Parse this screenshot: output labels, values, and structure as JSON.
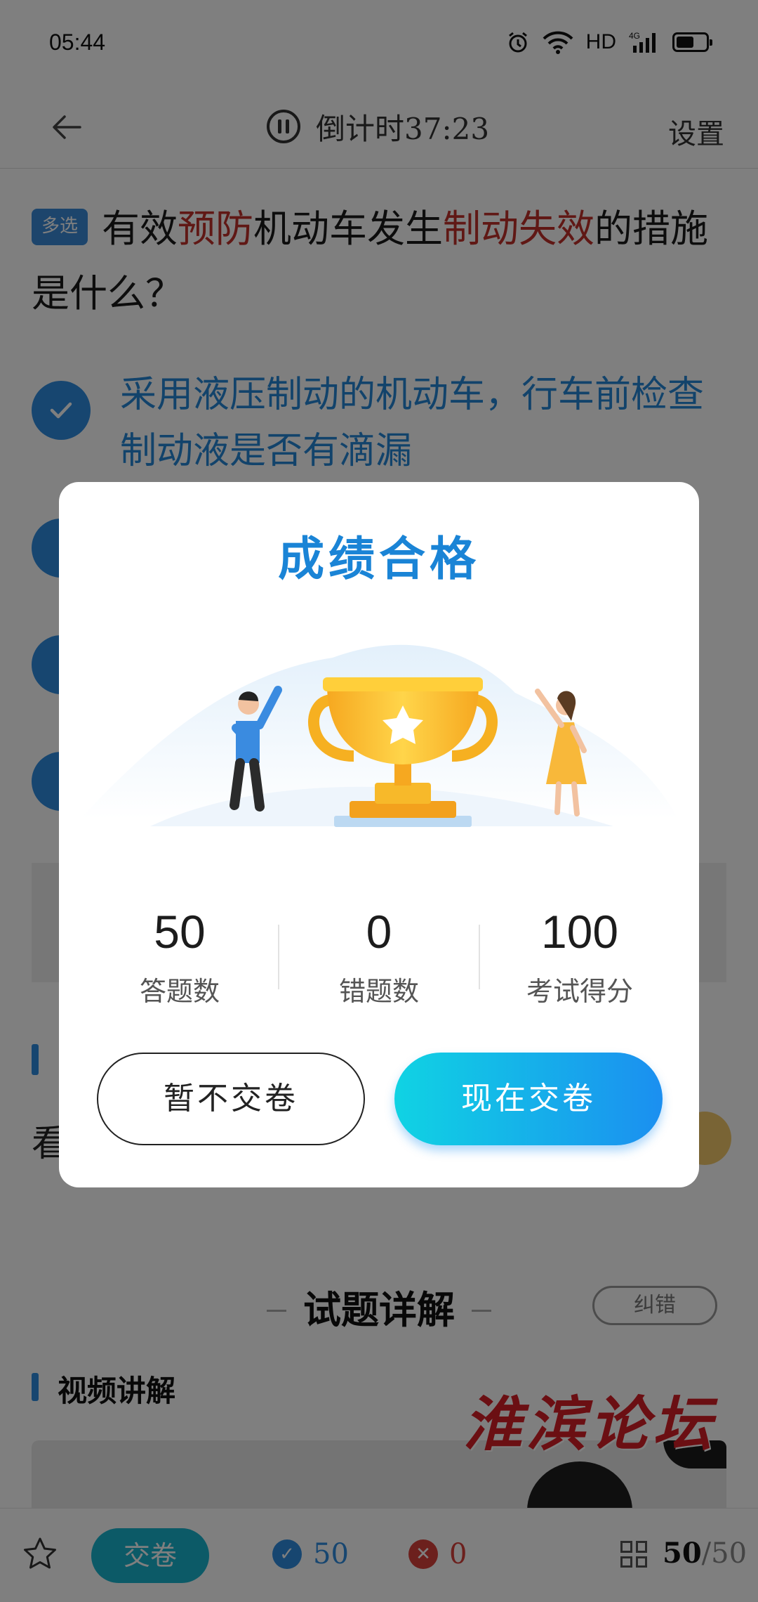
{
  "status_bar": {
    "time": "05:44",
    "network": "HD",
    "signal": "4G"
  },
  "nav": {
    "timer": "倒计时37:23",
    "settings": "设置"
  },
  "question": {
    "type_badge": "多选",
    "text_parts": [
      "有效",
      "预防",
      "机动车发生",
      "制动失效",
      "的措施是什么？"
    ]
  },
  "options": [
    {
      "text": "采用液压制动的机动车，行车前检查制动液是否有滴漏"
    }
  ],
  "partial_text": "看",
  "explain": {
    "title": "试题详解",
    "correct_button": "纠错",
    "video_title": "视频讲解"
  },
  "watermark": "淮滨论坛",
  "bottom": {
    "submit": "交卷",
    "correct_count": "50",
    "wrong_count": "0",
    "progress_current": "50",
    "progress_total": "/50"
  },
  "modal": {
    "title": "成绩合格",
    "stats": [
      {
        "value": "50",
        "label": "答题数"
      },
      {
        "value": "0",
        "label": "错题数"
      },
      {
        "value": "100",
        "label": "考试得分"
      }
    ],
    "cancel_button": "暂不交卷",
    "submit_button": "现在交卷"
  },
  "colors": {
    "accent": "#2e8ce0",
    "keyword": "#c0302a",
    "title_blue": "#1a84d6",
    "gradient_start": "#10d3e3",
    "gradient_end": "#1b8ff0",
    "trophy_gold": "#f7b92a"
  }
}
